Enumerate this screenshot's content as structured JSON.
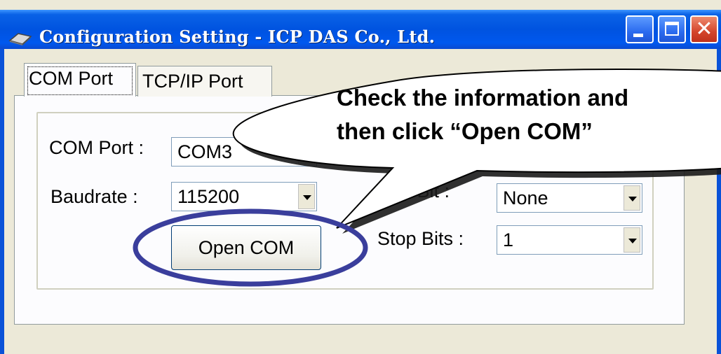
{
  "window": {
    "title": "Configuration Setting - ICP DAS Co., Ltd.",
    "caption_buttons": [
      "minimize-icon",
      "maximize-icon",
      "close-icon"
    ],
    "close_glyph": "✕"
  },
  "tabs": [
    {
      "label": "COM Port",
      "selected": true
    },
    {
      "label": "TCP/IP Port",
      "selected": false
    }
  ],
  "form": {
    "com_port": {
      "label": "COM Port :",
      "value": "COM3"
    },
    "baudrate": {
      "label": "Baudrate :",
      "value": "115200"
    },
    "parity": {
      "label_visible": "ity Bit :",
      "value": "None"
    },
    "stop_bits": {
      "label": "Stop Bits :",
      "value": "1"
    },
    "open_button": "Open COM"
  },
  "callout": {
    "line1": "Check the information and",
    "line2": "then click “Open COM”"
  },
  "colors": {
    "titlebar": "#0053e0",
    "window_bg": "#ece9d8",
    "annotation_ellipse": "#3a3e9c",
    "close_button": "#d4452b"
  }
}
